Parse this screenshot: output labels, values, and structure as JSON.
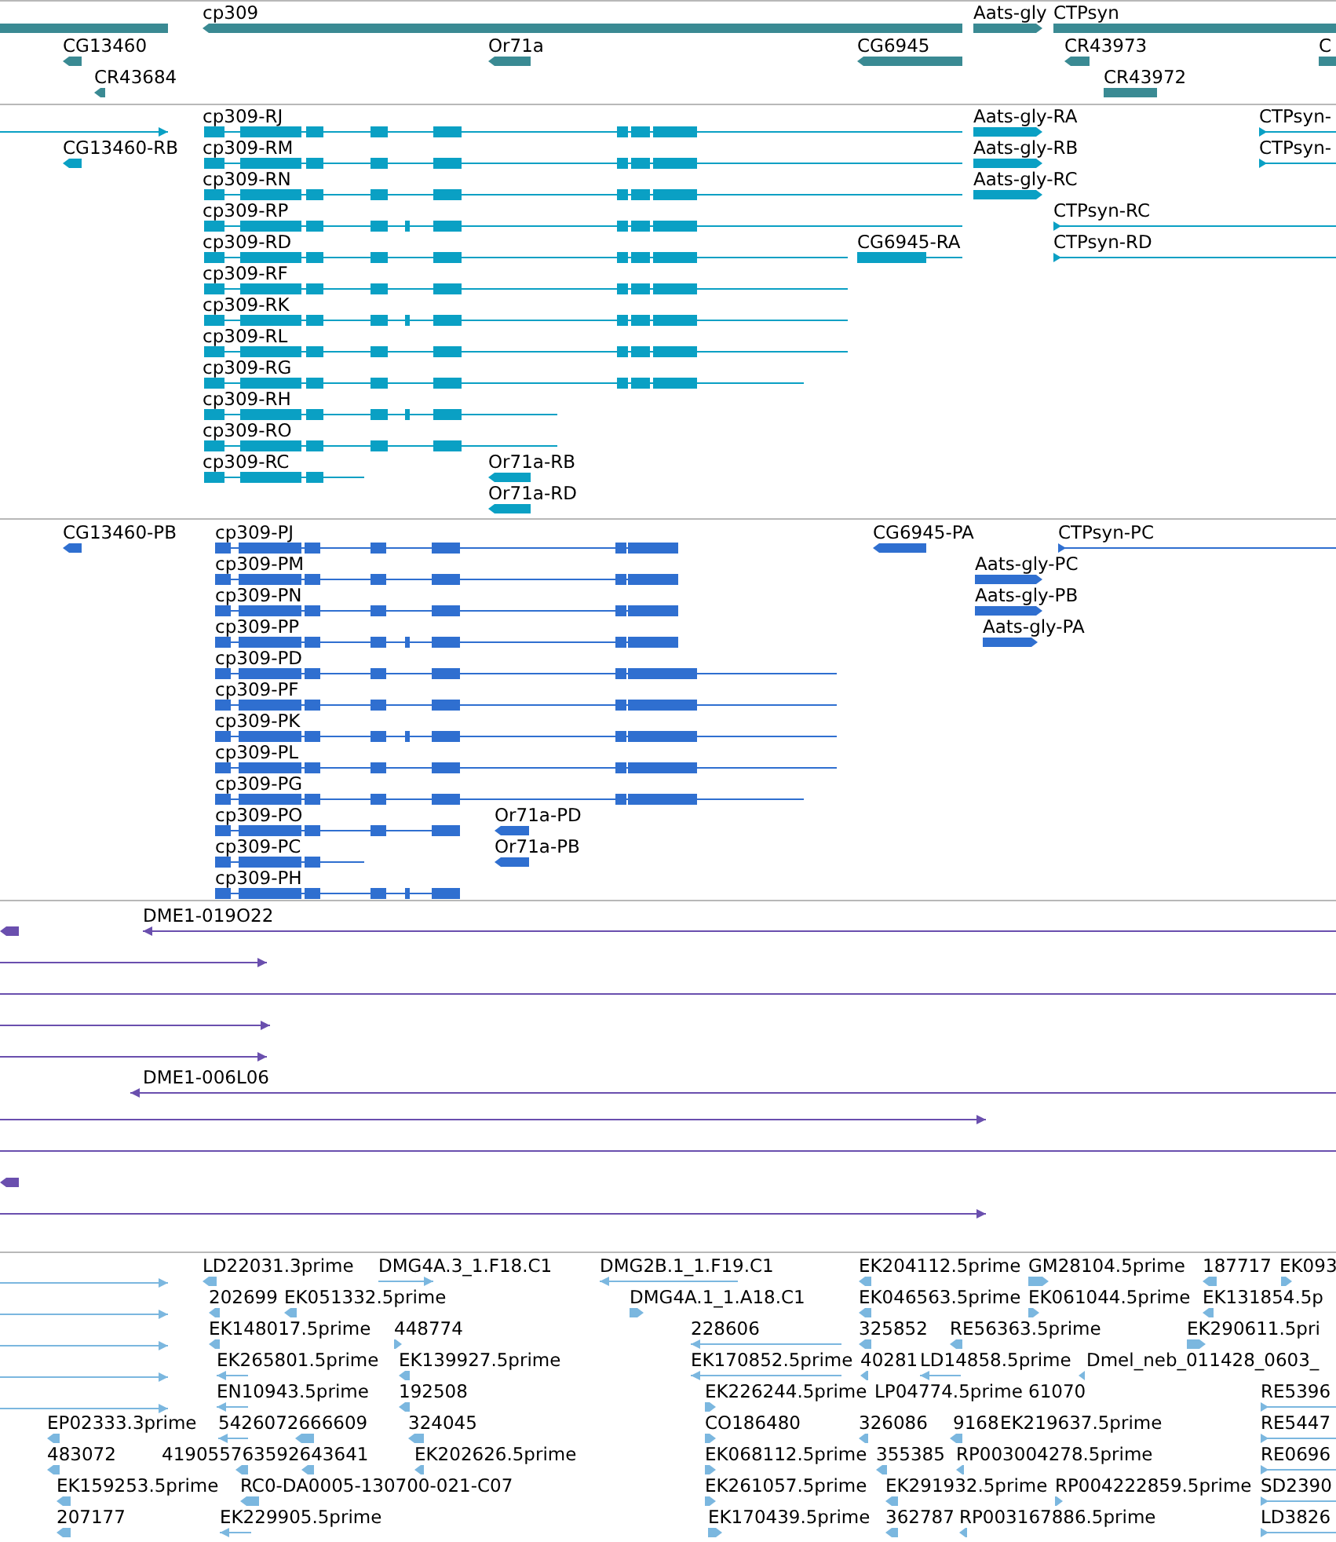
{
  "tracks": [
    {
      "kind": "gene",
      "features": [
        {
          "label": "cp309"
        },
        {
          "label": "Aats-gly"
        },
        {
          "label": "CTPsyn"
        },
        {
          "label": "CG13460"
        },
        {
          "label": "Or71a"
        },
        {
          "label": "CG6945"
        },
        {
          "label": "CR43973"
        },
        {
          "label": "C"
        },
        {
          "label": "CR43684"
        },
        {
          "label": "CR43972"
        }
      ]
    },
    {
      "kind": "transcript",
      "features": [
        {
          "label": "cp309-RJ"
        },
        {
          "label": "Aats-gly-RA"
        },
        {
          "label": "CTPsyn-"
        },
        {
          "label": "CG13460-RB"
        },
        {
          "label": "cp309-RM"
        },
        {
          "label": "Aats-gly-RB"
        },
        {
          "label": "CTPsyn-"
        },
        {
          "label": "cp309-RN"
        },
        {
          "label": "Aats-gly-RC"
        },
        {
          "label": "cp309-RP"
        },
        {
          "label": "CTPsyn-RC"
        },
        {
          "label": "cp309-RD"
        },
        {
          "label": "CG6945-RA"
        },
        {
          "label": "CTPsyn-RD"
        },
        {
          "label": "cp309-RF"
        },
        {
          "label": "cp309-RK"
        },
        {
          "label": "cp309-RL"
        },
        {
          "label": "cp309-RG"
        },
        {
          "label": "cp309-RH"
        },
        {
          "label": "cp309-RO"
        },
        {
          "label": "cp309-RC"
        },
        {
          "label": "Or71a-RB"
        },
        {
          "label": "Or71a-RD"
        }
      ]
    },
    {
      "kind": "protein",
      "features": [
        {
          "label": "CG13460-PB"
        },
        {
          "label": "cp309-PJ"
        },
        {
          "label": "CG6945-PA"
        },
        {
          "label": "CTPsyn-PC"
        },
        {
          "label": "cp309-PM"
        },
        {
          "label": "Aats-gly-PC"
        },
        {
          "label": "cp309-PN"
        },
        {
          "label": "Aats-gly-PB"
        },
        {
          "label": "cp309-PP"
        },
        {
          "label": "Aats-gly-PA"
        },
        {
          "label": "cp309-PD"
        },
        {
          "label": "cp309-PF"
        },
        {
          "label": "cp309-PK"
        },
        {
          "label": "cp309-PL"
        },
        {
          "label": "cp309-PG"
        },
        {
          "label": "cp309-PO"
        },
        {
          "label": "Or71a-PD"
        },
        {
          "label": "cp309-PC"
        },
        {
          "label": "Or71a-PB"
        },
        {
          "label": "cp309-PH"
        }
      ]
    },
    {
      "kind": "clone",
      "features": [
        {
          "label": "DME1-019O22"
        },
        {
          "label": "DME1-006L06"
        }
      ]
    },
    {
      "kind": "est",
      "features": [
        {
          "label": "LD22031.3prime"
        },
        {
          "label": "DMG4A.3_1.F18.C1"
        },
        {
          "label": "DMG2B.1_1.F19.C1"
        },
        {
          "label": "EK204112.5prime"
        },
        {
          "label": "GM28104.5prime"
        },
        {
          "label": "187717"
        },
        {
          "label": "EK093"
        },
        {
          "label": "202699"
        },
        {
          "label": "EK051332.5prime"
        },
        {
          "label": "DMG4A.1_1.A18.C1"
        },
        {
          "label": "EK046563.5prime"
        },
        {
          "label": "EK061044.5prime"
        },
        {
          "label": "EK131854.5p"
        },
        {
          "label": "EK148017.5prime"
        },
        {
          "label": "448774"
        },
        {
          "label": "228606"
        },
        {
          "label": "325852"
        },
        {
          "label": "RE56363.5prime"
        },
        {
          "label": "EK290611.5pri"
        },
        {
          "label": "EK265801.5prime"
        },
        {
          "label": "EK139927.5prime"
        },
        {
          "label": "EK170852.5prime"
        },
        {
          "label": "40281"
        },
        {
          "label": "LD14858.5prime"
        },
        {
          "label": "Dmel_neb_011428_0603_"
        },
        {
          "label": "EN10943.5prime"
        },
        {
          "label": "192508"
        },
        {
          "label": "EK226244.5prime"
        },
        {
          "label": "LP04774.5prime"
        },
        {
          "label": "61070"
        },
        {
          "label": "RE5396"
        },
        {
          "label": "EP02333.3prime"
        },
        {
          "label": "5426072666609"
        },
        {
          "label": "324045"
        },
        {
          "label": "CO186480"
        },
        {
          "label": "326086"
        },
        {
          "label": "9168"
        },
        {
          "label": "EK219637.5prime"
        },
        {
          "label": "RE5447"
        },
        {
          "label": "483072"
        },
        {
          "label": "419055763592643641"
        },
        {
          "label": "EK202626.5prime"
        },
        {
          "label": "EK068112.5prime"
        },
        {
          "label": "355385"
        },
        {
          "label": "RP003004278.5prime"
        },
        {
          "label": "RE0696"
        },
        {
          "label": "EK159253.5prime"
        },
        {
          "label": "RC0-DA0005-130700-021-C07"
        },
        {
          "label": "EK261057.5prime"
        },
        {
          "label": "EK291932.5prime"
        },
        {
          "label": "RP004222859.5prime"
        },
        {
          "label": "SD2390"
        },
        {
          "label": "207177"
        },
        {
          "label": "EK229905.5prime"
        },
        {
          "label": "EK170439.5prime"
        },
        {
          "label": "362787"
        },
        {
          "label": "RP003167886.5prime"
        },
        {
          "label": "LD3826"
        }
      ]
    }
  ]
}
